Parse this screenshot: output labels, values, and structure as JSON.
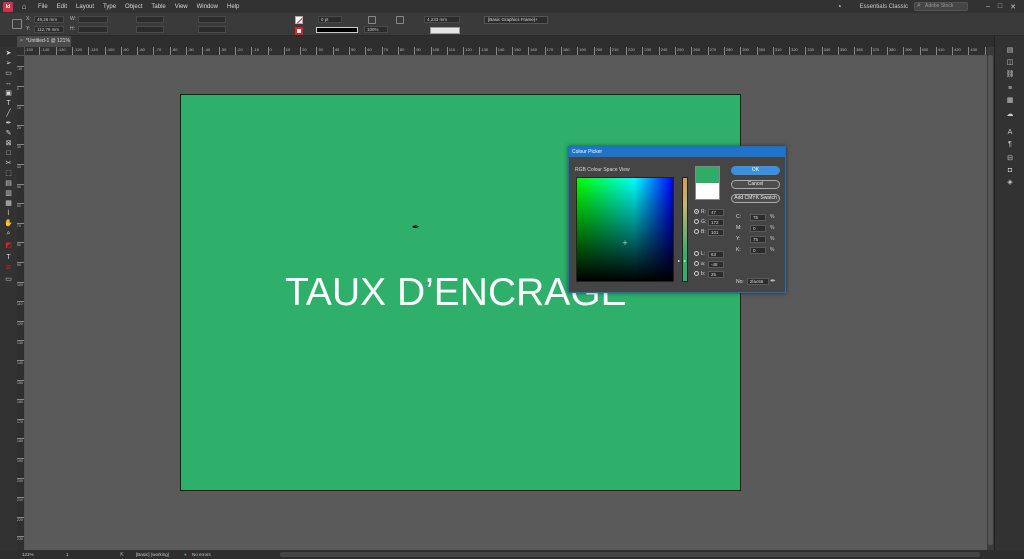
{
  "app": {
    "icon_text": "Id"
  },
  "menubar": {
    "items": [
      "File",
      "Edit",
      "Layout",
      "Type",
      "Object",
      "Table",
      "View",
      "Window",
      "Help"
    ],
    "workspace": "Essentials Classic",
    "search_placeholder": "Adobe Stock"
  },
  "controlbar": {
    "x_label": "X:",
    "x_value": "49,26 mm",
    "y_label": "Y:",
    "y_value": "112,79 mm",
    "w_label": "W:",
    "h_label": "H:",
    "stroke_weight": "0 pt",
    "opacity": "100%",
    "offset": "4,233 mm",
    "frame_style": "[Basic Graphics Frame]+"
  },
  "document": {
    "tab_title": "*Untitled-1 @ 121%",
    "page_text": "TAUX D’ENCRAGE",
    "page_color": "#2eaf6a"
  },
  "ruler": {
    "top_ticks": [
      "-150",
      "-140",
      "-130",
      "-120",
      "-110",
      "-100",
      "-90",
      "-80",
      "-70",
      "-60",
      "-50",
      "-40",
      "-30",
      "-20",
      "-10",
      "0",
      "10",
      "20",
      "30",
      "40",
      "50",
      "60",
      "70",
      "80",
      "90",
      "100",
      "110",
      "120",
      "130",
      "140",
      "150",
      "160",
      "170",
      "180",
      "190",
      "200",
      "210",
      "220",
      "230",
      "240",
      "250",
      "260",
      "270",
      "280",
      "290",
      "300",
      "310",
      "320",
      "330",
      "340",
      "350",
      "360",
      "370",
      "380",
      "390",
      "400",
      "410",
      "420",
      "430",
      "440"
    ],
    "left_ticks": [
      "-10",
      "0",
      "10",
      "20",
      "30",
      "40",
      "50",
      "60",
      "70",
      "80",
      "90",
      "100",
      "110",
      "120",
      "130",
      "140",
      "150",
      "160",
      "170",
      "180",
      "190",
      "200",
      "210",
      "220",
      "230",
      "240"
    ]
  },
  "statusbar": {
    "zoom": "121%",
    "page": "1",
    "style": "[Basic] (working)",
    "errors": "No errors"
  },
  "colour_picker": {
    "title": "Colour Picker",
    "subtitle": "RGB Colour Space View",
    "ok": "OK",
    "cancel": "Cancel",
    "add_swatch": "Add CMYK Swatch",
    "new_color": "#2fac65",
    "old_color": "#ffffff",
    "rgb": [
      {
        "label": "R:",
        "value": "47"
      },
      {
        "label": "G:",
        "value": "172"
      },
      {
        "label": "B:",
        "value": "101"
      }
    ],
    "lab": [
      {
        "label": "L:",
        "value": "63"
      },
      {
        "label": "a:",
        "value": "-48"
      },
      {
        "label": "b:",
        "value": "25"
      }
    ],
    "cmyk": [
      {
        "label": "C:",
        "value": "75",
        "unit": "%"
      },
      {
        "label": "M:",
        "value": "0",
        "unit": "%"
      },
      {
        "label": "Y:",
        "value": "75",
        "unit": "%"
      },
      {
        "label": "K:",
        "value": "0",
        "unit": "%"
      }
    ],
    "hex_label": "No:",
    "hex_value": "2fac66"
  }
}
